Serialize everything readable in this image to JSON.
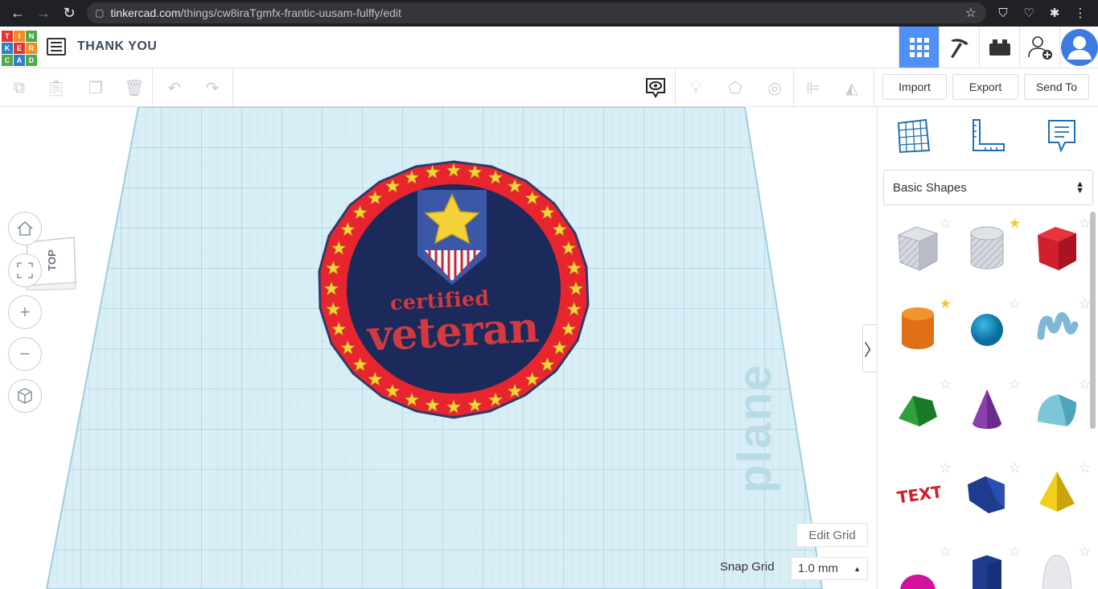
{
  "browser": {
    "url_host": "tinkercad.com",
    "url_path": "/things/cw8iraTgmfx-frantic-uusam-fulffy/edit"
  },
  "header": {
    "logo_letters": [
      "T",
      "I",
      "N",
      "K",
      "E",
      "R",
      "C",
      "A",
      "D"
    ],
    "design_title": "THANK YOU"
  },
  "toolbar": {
    "import_label": "Import",
    "export_label": "Export",
    "send_to_label": "Send To"
  },
  "workplane": {
    "view_cube_label": "TOP",
    "plane_watermark": "plane",
    "edit_grid_label": "Edit Grid",
    "snap_grid_label": "Snap Grid",
    "snap_grid_value": "1.0 mm"
  },
  "design": {
    "text_line_1": "certified",
    "text_line_2": "veteran",
    "colors": {
      "ring": "#e8252f",
      "disc": "#1b2a5a",
      "shield": "#3b57a8",
      "star": "#f3d23a",
      "text": "#d23a3f"
    }
  },
  "panel": {
    "category": "Basic Shapes",
    "shapes": [
      {
        "name": "box-hole",
        "favorite": false
      },
      {
        "name": "cylinder-hole",
        "favorite": true
      },
      {
        "name": "box",
        "favorite": false
      },
      {
        "name": "cylinder",
        "favorite": true
      },
      {
        "name": "sphere",
        "favorite": false
      },
      {
        "name": "scribble",
        "favorite": false
      },
      {
        "name": "roof",
        "favorite": false
      },
      {
        "name": "cone",
        "favorite": false
      },
      {
        "name": "round-roof",
        "favorite": false
      },
      {
        "name": "text",
        "favorite": false
      },
      {
        "name": "wedge",
        "favorite": false
      },
      {
        "name": "pyramid",
        "favorite": false
      },
      {
        "name": "half-sphere",
        "favorite": false
      },
      {
        "name": "polygon",
        "favorite": false
      },
      {
        "name": "paraboloid",
        "favorite": false
      }
    ]
  }
}
